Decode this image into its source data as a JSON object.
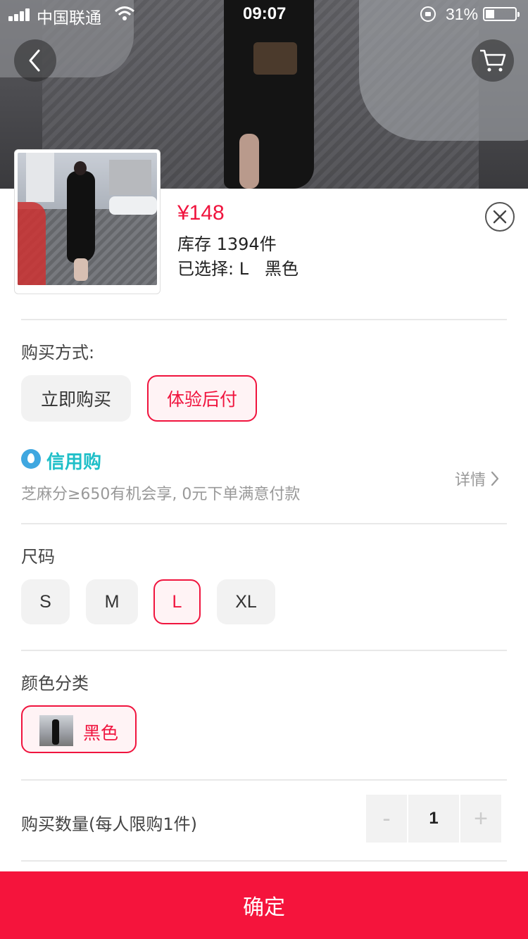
{
  "status_bar": {
    "carrier": "中国联通",
    "time": "09:07",
    "battery_percent": "31%",
    "battery_level": 0.31
  },
  "hero": {
    "back_icon": "chevron-left-icon",
    "cart_icon": "cart-icon"
  },
  "product": {
    "price": "¥148",
    "stock": "库存 1394件",
    "selected": "已选择: L   黑色"
  },
  "purchase_method": {
    "label": "购买方式:",
    "options": [
      "立即购买",
      "体验后付"
    ],
    "selected_index": 1
  },
  "credit": {
    "title": "信用购",
    "description": "芝麻分≥650有机会享, 0元下单满意付款",
    "detail_label": "详情"
  },
  "size": {
    "label": "尺码",
    "options": [
      "S",
      "M",
      "L",
      "XL"
    ],
    "selected": "L"
  },
  "color": {
    "label": "颜色分类",
    "options": [
      "黑色"
    ],
    "selected": "黑色"
  },
  "quantity": {
    "label": "购买数量(每人限购1件)",
    "minus": "-",
    "value": "1",
    "plus": "+"
  },
  "confirm_label": "确定",
  "colors": {
    "accent": "#f0143e",
    "confirm_bg": "#f5143c",
    "credit_text": "#1fbfc8"
  }
}
